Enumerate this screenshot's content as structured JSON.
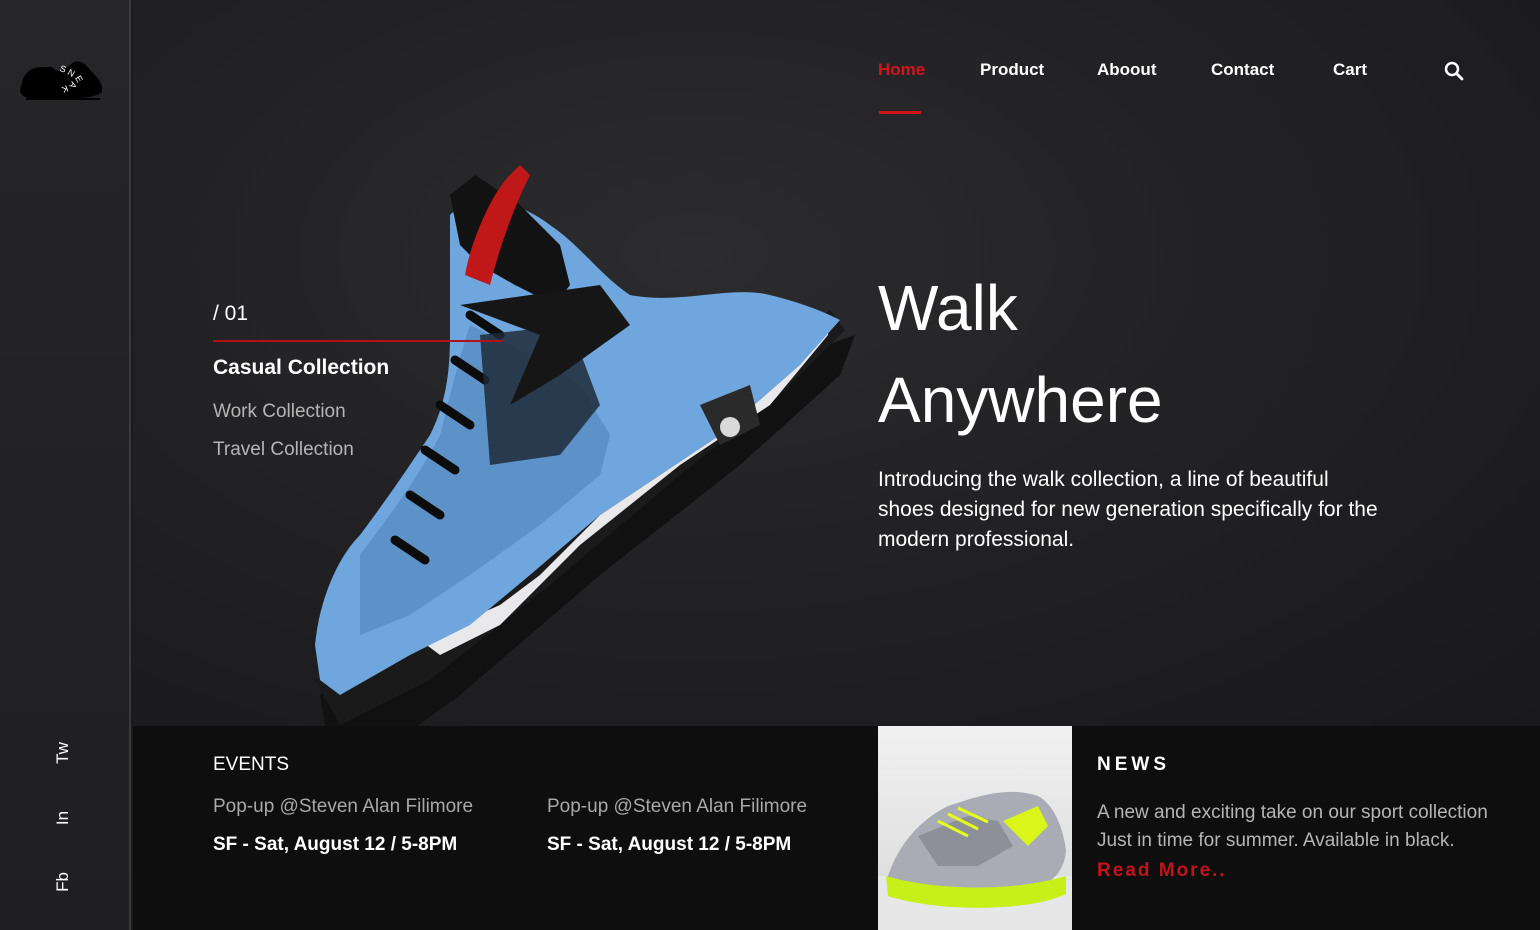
{
  "brand": {
    "logo_letters": "SNEAKA",
    "logo_icon": "sneaker-silhouette-icon"
  },
  "social": {
    "twitter": "Tw",
    "linkedin": "In",
    "facebook": "Fb"
  },
  "nav": {
    "items": [
      {
        "label": "Home",
        "active": true
      },
      {
        "label": "Product",
        "active": false
      },
      {
        "label": "Aboout",
        "active": false
      },
      {
        "label": "Contact",
        "active": false
      },
      {
        "label": "Cart",
        "active": false
      }
    ],
    "search_icon": "search-icon"
  },
  "collections": {
    "slide_number": "/ 01",
    "items": [
      "Casual Collection",
      "Work Collection",
      "Travel Collection"
    ],
    "active_index": 0
  },
  "hero": {
    "headline_line1": "Walk",
    "headline_line2": "Anywhere",
    "intro": "Introducing the walk collection, a line of beautiful shoes designed for new generation specifically for the modern professional."
  },
  "events": {
    "title": "EVENTS",
    "items": [
      {
        "name": "Pop-up @Steven Alan Filimore",
        "date": "SF - Sat, August 12 / 5-8PM"
      },
      {
        "name": "Pop-up @Steven Alan Filimore",
        "date": "SF - Sat, August 12 / 5-8PM"
      }
    ]
  },
  "news": {
    "title": "NEWS",
    "line1": "A new and exciting take on our sport collection",
    "line2": "Just in time for summer. Available in black.",
    "read_more": "Read More.."
  },
  "colors": {
    "accent": "#d4141d",
    "background": "#1b1b1d",
    "rail": "#262628",
    "bottom_bar": "#0e0e0f"
  }
}
